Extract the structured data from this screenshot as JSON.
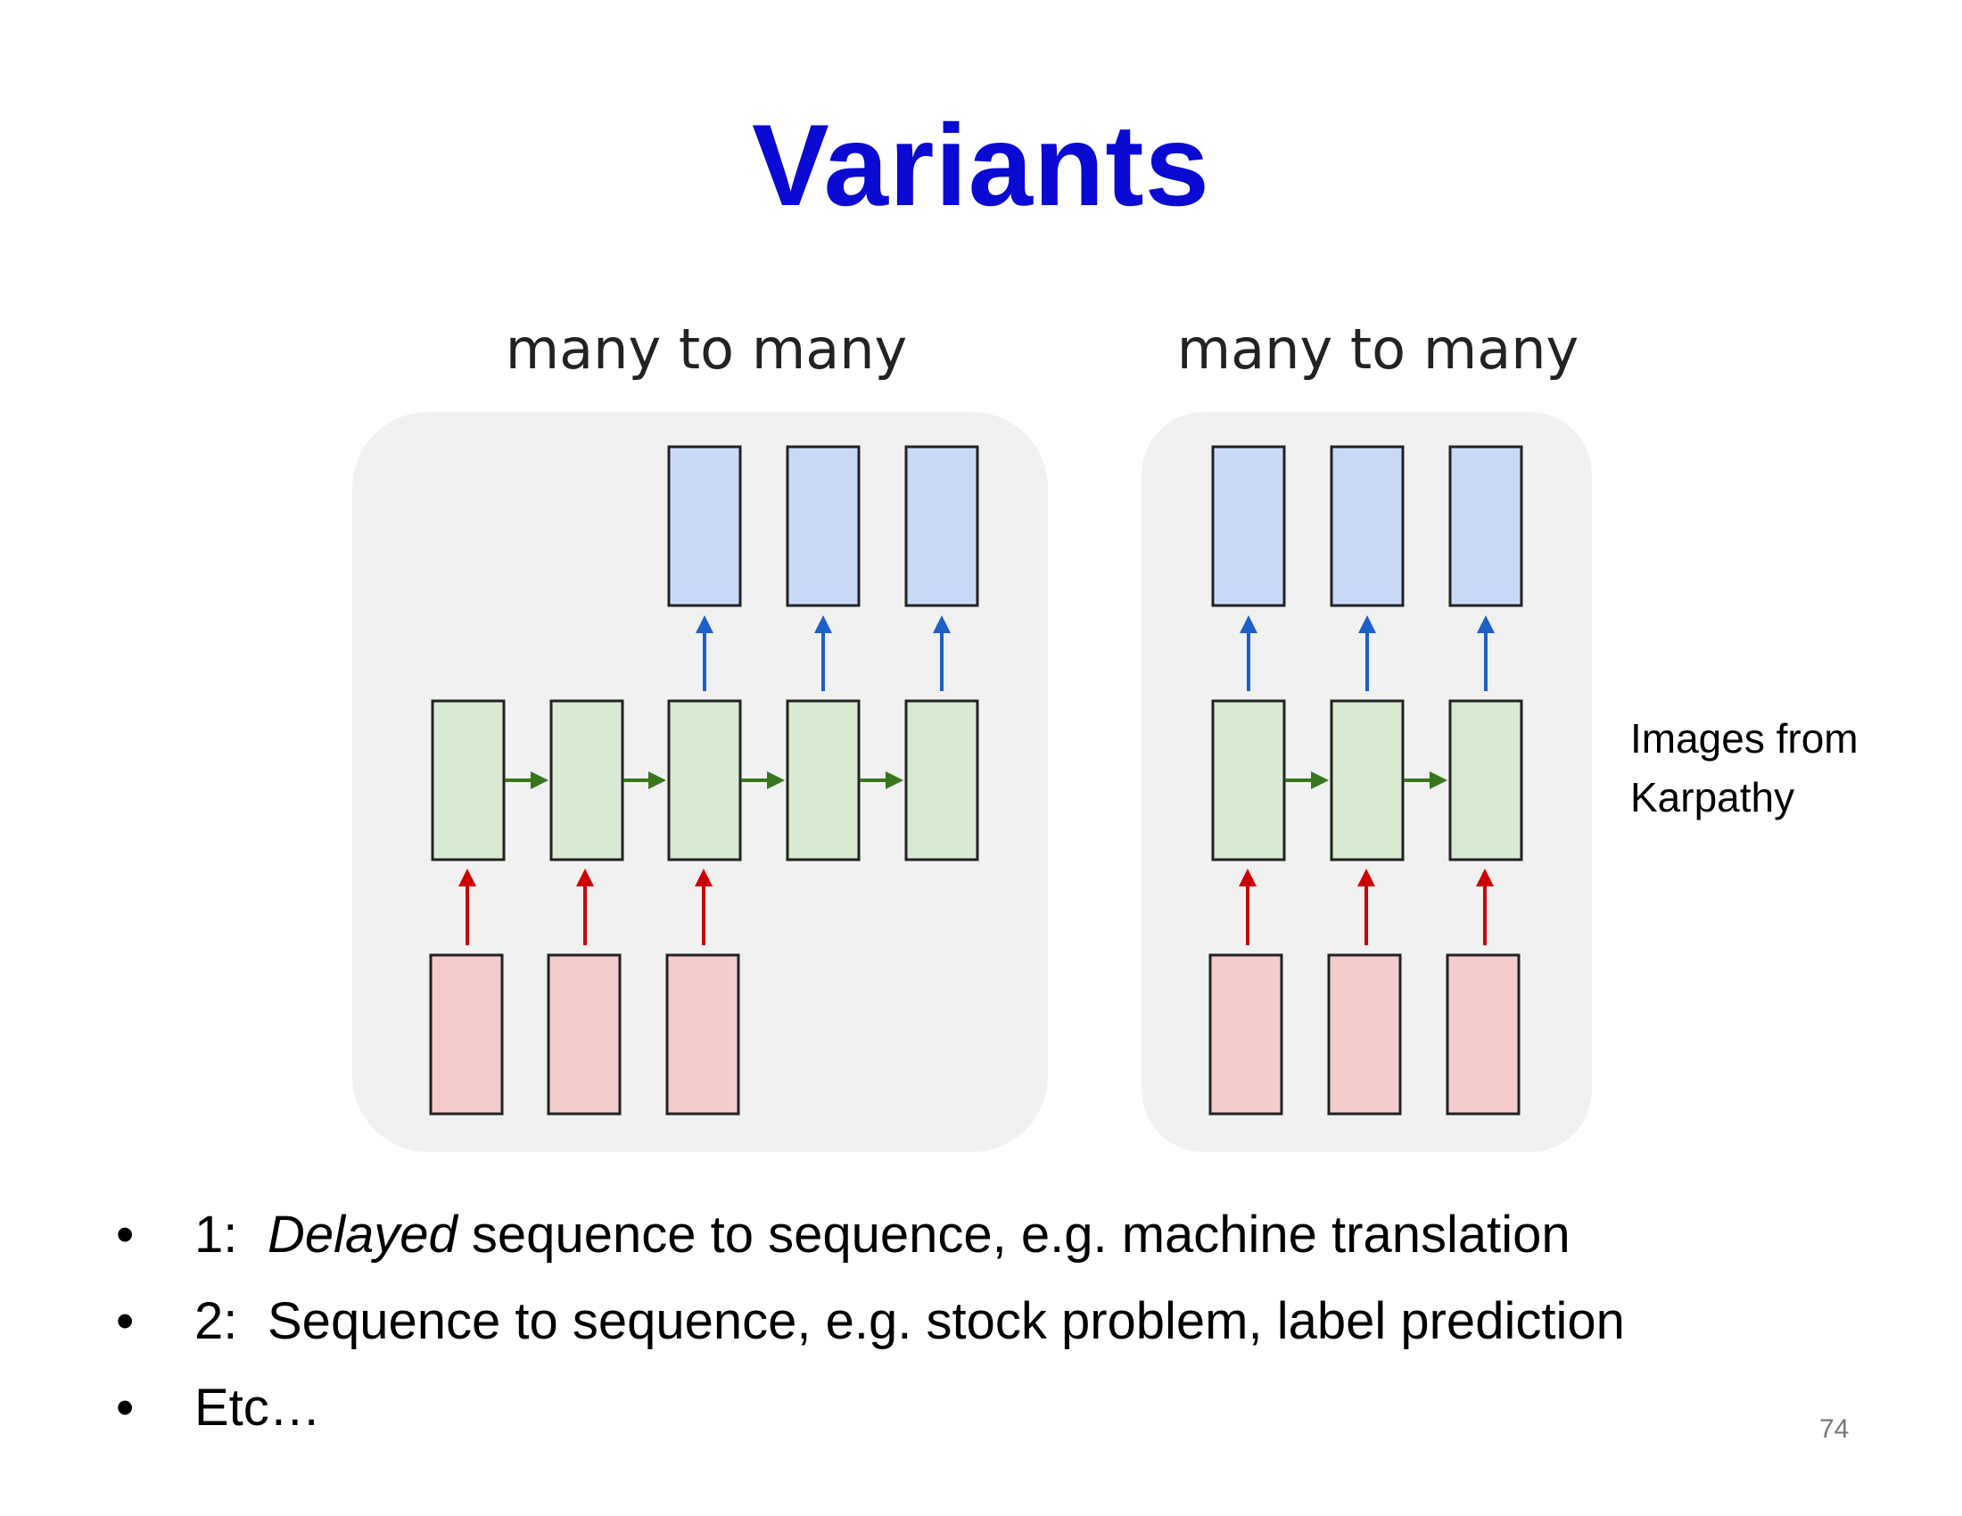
{
  "slide": {
    "title": "Variants",
    "page_number": "74",
    "credit": [
      "Images from",
      "Karpathy"
    ]
  },
  "diagrams": [
    {
      "title": "many to many"
    },
    {
      "title": "many to many"
    }
  ],
  "bullets": [
    {
      "number": "1:",
      "emph": "Delayed",
      "text": " sequence to sequence, e.g. machine translation"
    },
    {
      "number": "2:",
      "text": "Sequence to sequence, e.g. stock problem, label prediction"
    },
    {
      "text": "Etc…"
    }
  ],
  "bullet_glyph": "•",
  "colors": {
    "title": "#0a0ad2",
    "output_box": "#c9daf8",
    "hidden_box": "#d9ead3",
    "input_box": "#f4cccc",
    "output_arrow": "#1c5fc8",
    "hidden_arrow": "#38761d",
    "input_arrow": "#cc0000",
    "panel": "#f1f1f1"
  }
}
